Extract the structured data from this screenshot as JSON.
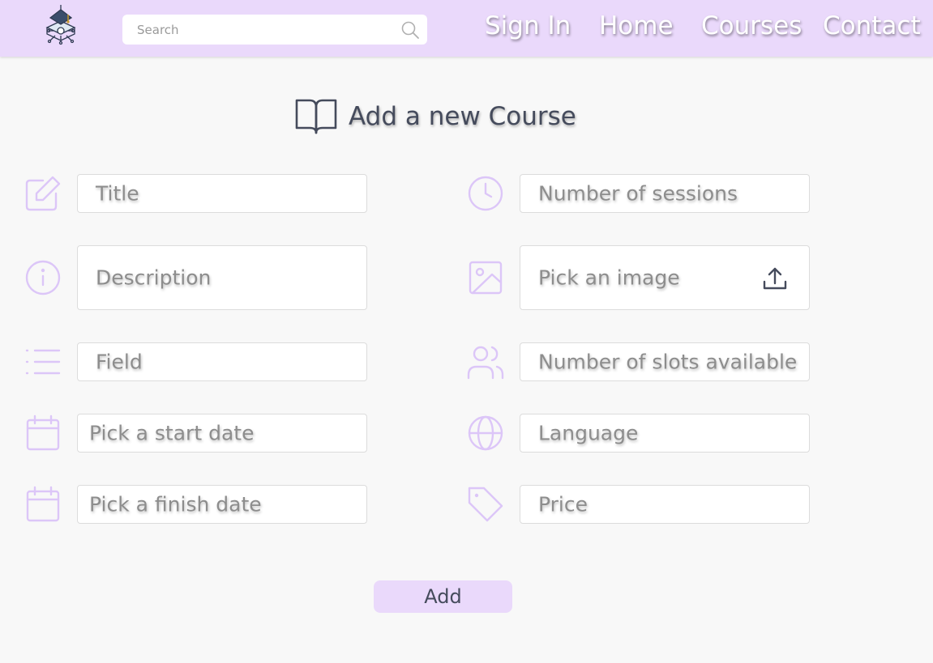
{
  "header": {
    "logo_icon": "graduation-cap-chip-logo",
    "search": {
      "placeholder": "Search",
      "icon": "search-icon"
    },
    "nav": [
      {
        "label": "Sign In"
      },
      {
        "label": "Home"
      },
      {
        "label": "Courses"
      },
      {
        "label": "Contact"
      }
    ]
  },
  "form": {
    "title": "Add a new Course",
    "title_icon": "book-icon",
    "left_fields": [
      {
        "label": "Title",
        "icon": "edit-icon"
      },
      {
        "label": "Description",
        "icon": "info-icon"
      },
      {
        "label": "Field",
        "icon": "list-icon"
      },
      {
        "label": "Pick a start date",
        "icon": "calendar-icon"
      },
      {
        "label": "Pick a finish date",
        "icon": "calendar-icon"
      }
    ],
    "right_fields": [
      {
        "label": "Number of sessions",
        "icon": "clock-icon"
      },
      {
        "label": "Pick an image",
        "icon": "image-icon"
      },
      {
        "label": "Number of slots available",
        "icon": "users-icon"
      },
      {
        "label": "Language",
        "icon": "globe-icon"
      },
      {
        "label": "Price",
        "icon": "tag-icon"
      }
    ],
    "submit_label": "Add"
  },
  "colors": {
    "header_bg": "#ead9fb",
    "icon_accent": "#dcc6f8",
    "text_dark": "#454b5c",
    "page_bg": "#f8f8f8"
  }
}
